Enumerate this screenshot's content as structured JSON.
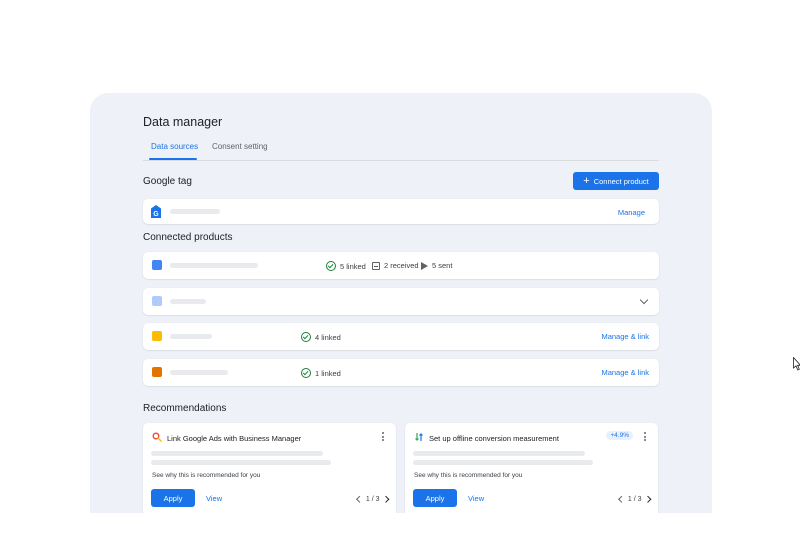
{
  "header": {
    "title": "Data manager"
  },
  "tabs": [
    {
      "label": "Data sources",
      "active": true
    },
    {
      "label": "Consent setting",
      "active": false
    }
  ],
  "google_tag": {
    "heading": "Google tag",
    "connect_label": "Connect product",
    "manage_label": "Manage",
    "icon": "google-tag-icon"
  },
  "connected_products": {
    "heading": "Connected products",
    "items": [
      {
        "color": "#4285f4",
        "linked": "5 linked",
        "received": "2 received",
        "sent": "5 sent"
      },
      {
        "color": "#aecbfa",
        "expandable": true
      },
      {
        "color": "#fbbc04",
        "linked": "4 linked",
        "action": "Manage & link"
      },
      {
        "color": "#e37400",
        "linked": "1 linked",
        "action": "Manage & link"
      }
    ]
  },
  "recommendations": {
    "heading": "Recommendations",
    "cards": [
      {
        "title": "Link Google Ads with Business Manager",
        "why": "See why this is recommended for you",
        "apply": "Apply",
        "view": "View",
        "pager": "1 / 3",
        "icon": "search-icon"
      },
      {
        "title": "Set up offline conversion measurement",
        "badge": "+4.9%",
        "why": "See why this is recommended for you",
        "apply": "Apply",
        "view": "View",
        "pager": "1 / 3",
        "icon": "conversion-icon"
      }
    ]
  },
  "colors": {
    "accent": "#1a73e8",
    "success": "#188038",
    "panel_bg": "#eef2f8"
  }
}
